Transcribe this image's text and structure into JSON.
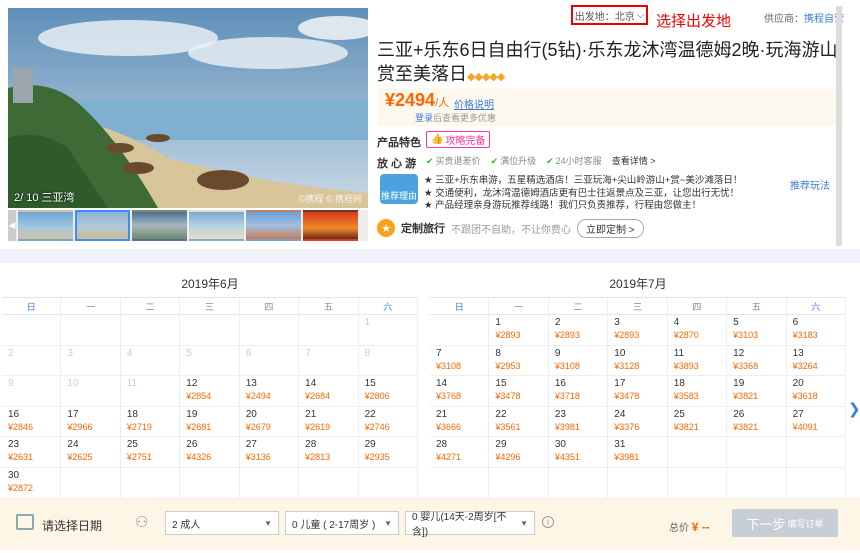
{
  "gallery": {
    "caption": "2/ 10 三亚湾",
    "watermark": "©携程 © 携程网"
  },
  "header": {
    "departure_label": "出发地：北京",
    "departure_hint": "选择出发地",
    "supplier_label": "供应商：",
    "supplier_name": "携程自营"
  },
  "product": {
    "title": "三亚+乐东6日自由行(5钻)·乐东龙沐湾温德姆2晚·玩海游山·赏至美落日",
    "diamonds": "◆◆◆◆◆",
    "price": "¥2494",
    "price_unit": "/人",
    "price_note": "价格说明",
    "login_link": "登录",
    "login_suffix": "后查看更多优惠",
    "features_label": "产品特色",
    "feature_tag": "攻略完备",
    "relax_label": "放 心 游",
    "relax_items": [
      "买贵退差价",
      "满位升级",
      "24小时客服"
    ],
    "relax_link": "查看详情 >",
    "recommend_badge": "推荐理由",
    "recommend_lines": [
      "★ 三亚+乐东串游，五星精选酒店！三亚玩海+尖山岭游山+赏~美沙滩落日！",
      "★ 交通便利，龙沐湾温德姆酒店更有巴士往返景点及三亚，让您出行无忧！",
      "★ 产品经理亲身游玩推荐线路！我们只负责推荐，行程由您做主！"
    ],
    "recommend_link": "推荐玩法",
    "custom_title": "定制旅行",
    "custom_desc": "不跟团不自助，不让你费心",
    "custom_button": "立即定制 >"
  },
  "calendar": {
    "weekdays": [
      "日",
      "一",
      "二",
      "三",
      "四",
      "五",
      "六"
    ],
    "june": {
      "title": "2019年6月",
      "cells": [
        {
          "d": "",
          "p": ""
        },
        {
          "d": "",
          "p": ""
        },
        {
          "d": "",
          "p": ""
        },
        {
          "d": "",
          "p": ""
        },
        {
          "d": "",
          "p": ""
        },
        {
          "d": "",
          "p": ""
        },
        {
          "d": "1",
          "p": "",
          "dim": true
        },
        {
          "d": "2",
          "p": "",
          "dim": true
        },
        {
          "d": "3",
          "p": "",
          "dim": true
        },
        {
          "d": "4",
          "p": "",
          "dim": true
        },
        {
          "d": "5",
          "p": "",
          "dim": true
        },
        {
          "d": "6",
          "p": "",
          "dim": true
        },
        {
          "d": "7",
          "p": "",
          "dim": true
        },
        {
          "d": "8",
          "p": "",
          "dim": true
        },
        {
          "d": "9",
          "p": "",
          "dim": true
        },
        {
          "d": "10",
          "p": "",
          "dim": true
        },
        {
          "d": "11",
          "p": "",
          "dim": true
        },
        {
          "d": "12",
          "p": "¥2854"
        },
        {
          "d": "13",
          "p": "¥2494"
        },
        {
          "d": "14",
          "p": "¥2684"
        },
        {
          "d": "15",
          "p": "¥2806"
        },
        {
          "d": "16",
          "p": "¥2846"
        },
        {
          "d": "17",
          "p": "¥2966"
        },
        {
          "d": "18",
          "p": "¥2719"
        },
        {
          "d": "19",
          "p": "¥2681"
        },
        {
          "d": "20",
          "p": "¥2679"
        },
        {
          "d": "21",
          "p": "¥2619"
        },
        {
          "d": "22",
          "p": "¥2746"
        },
        {
          "d": "23",
          "p": "¥2631"
        },
        {
          "d": "24",
          "p": "¥2625"
        },
        {
          "d": "25",
          "p": "¥2751"
        },
        {
          "d": "26",
          "p": "¥4326"
        },
        {
          "d": "27",
          "p": "¥3136"
        },
        {
          "d": "28",
          "p": "¥2813"
        },
        {
          "d": "29",
          "p": "¥2935"
        },
        {
          "d": "30",
          "p": "¥2872"
        },
        {
          "d": "",
          "p": ""
        },
        {
          "d": "",
          "p": ""
        },
        {
          "d": "",
          "p": ""
        },
        {
          "d": "",
          "p": ""
        },
        {
          "d": "",
          "p": ""
        },
        {
          "d": "",
          "p": ""
        }
      ]
    },
    "july": {
      "title": "2019年7月",
      "cells": [
        {
          "d": "",
          "p": ""
        },
        {
          "d": "1",
          "p": "¥2893"
        },
        {
          "d": "2",
          "p": "¥2893"
        },
        {
          "d": "3",
          "p": "¥2893"
        },
        {
          "d": "4",
          "p": "¥2870"
        },
        {
          "d": "5",
          "p": "¥3103"
        },
        {
          "d": "6",
          "p": "¥3183"
        },
        {
          "d": "7",
          "p": "¥3108"
        },
        {
          "d": "8",
          "p": "¥2953"
        },
        {
          "d": "9",
          "p": "¥3108"
        },
        {
          "d": "10",
          "p": "¥3128"
        },
        {
          "d": "11",
          "p": "¥3893"
        },
        {
          "d": "12",
          "p": "¥3368"
        },
        {
          "d": "13",
          "p": "¥3264"
        },
        {
          "d": "14",
          "p": "¥3768"
        },
        {
          "d": "15",
          "p": "¥3478"
        },
        {
          "d": "16",
          "p": "¥3718"
        },
        {
          "d": "17",
          "p": "¥3478"
        },
        {
          "d": "18",
          "p": "¥3583"
        },
        {
          "d": "19",
          "p": "¥3821"
        },
        {
          "d": "20",
          "p": "¥3618"
        },
        {
          "d": "21",
          "p": "¥3666"
        },
        {
          "d": "22",
          "p": "¥3561"
        },
        {
          "d": "23",
          "p": "¥3981"
        },
        {
          "d": "24",
          "p": "¥3376"
        },
        {
          "d": "25",
          "p": "¥3821"
        },
        {
          "d": "26",
          "p": "¥3821"
        },
        {
          "d": "27",
          "p": "¥4091"
        },
        {
          "d": "28",
          "p": "¥4271"
        },
        {
          "d": "29",
          "p": "¥4296"
        },
        {
          "d": "30",
          "p": "¥4351"
        },
        {
          "d": "31",
          "p": "¥3981"
        },
        {
          "d": "",
          "p": ""
        },
        {
          "d": "",
          "p": ""
        },
        {
          "d": "",
          "p": ""
        },
        {
          "d": "",
          "p": ""
        },
        {
          "d": "",
          "p": ""
        },
        {
          "d": "",
          "p": ""
        },
        {
          "d": "",
          "p": ""
        },
        {
          "d": "",
          "p": ""
        },
        {
          "d": "",
          "p": ""
        },
        {
          "d": "",
          "p": ""
        }
      ]
    }
  },
  "booking": {
    "date_placeholder": "请选择日期",
    "adults": "2  成人",
    "children": "0  儿童 ( 2-17周岁 )",
    "infants": "0  婴儿(14天-2周岁[不含])",
    "total_label": "总价",
    "total_value": "¥ --",
    "next_label": "下一步",
    "next_sub": "填写订单"
  },
  "colors": {
    "accent": "#3b7dd8",
    "price": "#ff6600",
    "highlight": "#ee0000"
  }
}
